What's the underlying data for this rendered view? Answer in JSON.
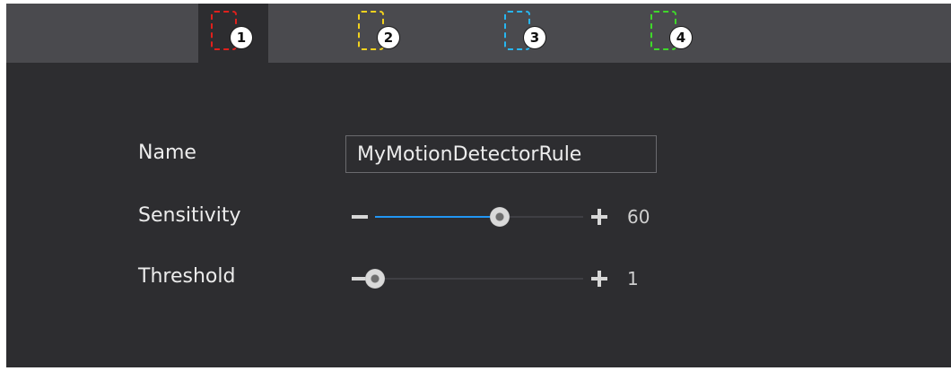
{
  "tabs": [
    {
      "label": "1",
      "color": "#e0201c",
      "active": true
    },
    {
      "label": "2",
      "color": "#f2d21e",
      "active": false
    },
    {
      "label": "3",
      "color": "#27b6f0",
      "active": false
    },
    {
      "label": "4",
      "color": "#3fd82a",
      "active": false
    }
  ],
  "form": {
    "name_label": "Name",
    "name_value": "MyMotionDetectorRule",
    "sensitivity_label": "Sensitivity",
    "sensitivity_value": "60",
    "sensitivity_fraction": 0.6,
    "threshold_label": "Threshold",
    "threshold_value": "1",
    "threshold_fraction": 0.0
  },
  "icons": {
    "decrease": "minus-icon",
    "increase": "plus-icon"
  },
  "colors": {
    "accent": "#2196f3",
    "panel_bg": "#2d2d30",
    "tabbar_bg": "#4a4a4e"
  }
}
